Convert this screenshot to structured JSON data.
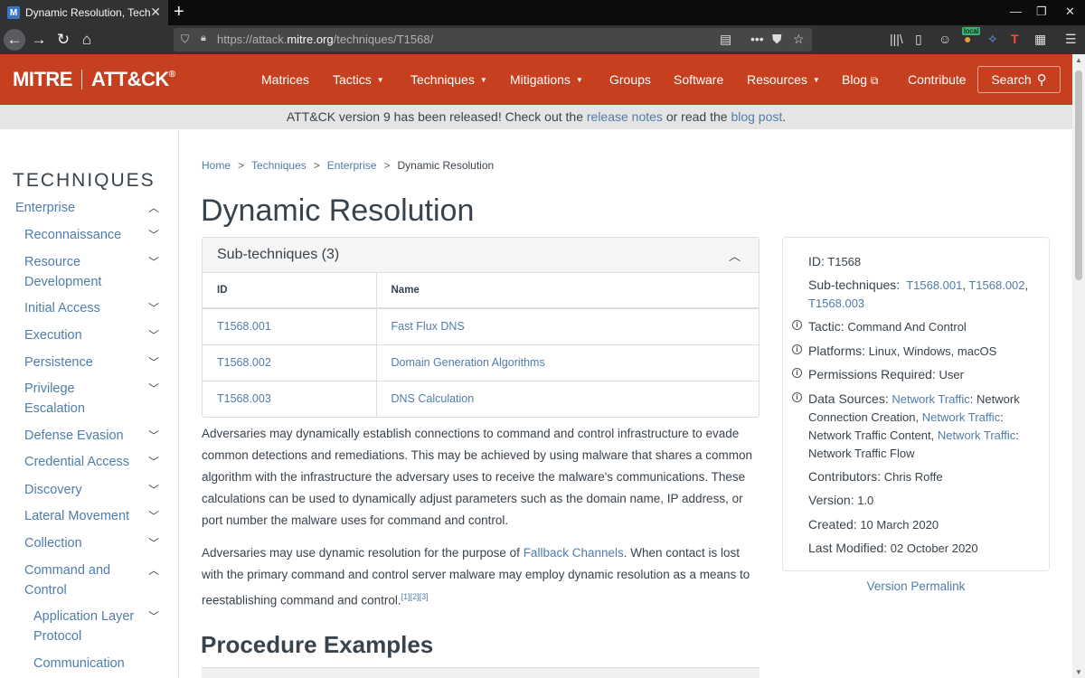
{
  "browser": {
    "tab_title": "Dynamic Resolution, Technique",
    "tab_favicon": "M",
    "url_host_prefix": "https://attack.",
    "url_host": "mitre.org",
    "url_path": "/techniques/T1568/",
    "local_badge": "local"
  },
  "header": {
    "logo_left": "MITRE",
    "logo_right": "ATT&CK",
    "logo_reg": "®",
    "nav": [
      {
        "label": "Matrices"
      },
      {
        "label": "Tactics"
      },
      {
        "label": "Techniques"
      },
      {
        "label": "Mitigations"
      },
      {
        "label": "Groups"
      },
      {
        "label": "Software"
      },
      {
        "label": "Resources"
      },
      {
        "label": "Blog"
      },
      {
        "label": "Contribute"
      }
    ],
    "search_label": "Search"
  },
  "banner": {
    "text_1": "ATT&CK version 9 has been released! Check out the ",
    "link_1": "release notes",
    "text_2": " or read the ",
    "link_2": "blog post",
    "text_3": "."
  },
  "sidebar": {
    "heading": "TECHNIQUES",
    "items": [
      {
        "label": "Enterprise",
        "chevron": "up"
      },
      {
        "label": "Reconnaissance",
        "chevron": "down"
      },
      {
        "label": "Resource Development",
        "chevron": "down"
      },
      {
        "label": "Initial Access",
        "chevron": "down"
      },
      {
        "label": "Execution",
        "chevron": "down"
      },
      {
        "label": "Persistence",
        "chevron": "down"
      },
      {
        "label": "Privilege Escalation",
        "chevron": "down"
      },
      {
        "label": "Defense Evasion",
        "chevron": "down"
      },
      {
        "label": "Credential Access",
        "chevron": "down"
      },
      {
        "label": "Discovery",
        "chevron": "down"
      },
      {
        "label": "Lateral Movement",
        "chevron": "down"
      },
      {
        "label": "Collection",
        "chevron": "down"
      },
      {
        "label": "Command and Control",
        "chevron": "up"
      },
      {
        "label": "Application Layer Protocol",
        "chevron": "down"
      },
      {
        "label": "Communication"
      }
    ]
  },
  "breadcrumb": [
    "Home",
    "Techniques",
    "Enterprise",
    "Dynamic Resolution"
  ],
  "page_title": "Dynamic Resolution",
  "subtechniques": {
    "title": "Sub-techniques (3)",
    "col_id": "ID",
    "col_name": "Name",
    "rows": [
      {
        "id": "T1568.001",
        "name": "Fast Flux DNS"
      },
      {
        "id": "T1568.002",
        "name": "Domain Generation Algorithms"
      },
      {
        "id": "T1568.003",
        "name": "DNS Calculation"
      }
    ]
  },
  "description": {
    "para1": "Adversaries may dynamically establish connections to command and control infrastructure to evade common detections and remediations. This may be achieved by using malware that shares a common algorithm with the infrastructure the adversary uses to receive the malware's communications. These calculations can be used to dynamically adjust parameters such as the domain name, IP address, or port number the malware uses for command and control.",
    "para2_a": "Adversaries may use dynamic resolution for the purpose of ",
    "para2_link": "Fallback Channels",
    "para2_b": ". When contact is lost with the primary command and control server malware may employ dynamic resolution as a means to reestablishing command and control.",
    "refs": "[1][2][3]"
  },
  "procedure_heading": "Procedure Examples",
  "card": {
    "id_label": "ID:",
    "id_value": "T1568",
    "subtech_label": "Sub-techniques:",
    "subtech_links": [
      "T1568.001",
      "T1568.002",
      "T1568.003"
    ],
    "tactic_label": "Tactic:",
    "tactic_value": "Command And Control",
    "platforms_label": "Platforms:",
    "platforms_value": "Linux, Windows, macOS",
    "perms_label": "Permissions Required:",
    "perms_value": "User",
    "datasrc_label": "Data Sources:",
    "datasrc_link": "Network Traffic",
    "datasrc_1": ": Network Connection Creation, ",
    "datasrc_2": ": Network Traffic Content, ",
    "datasrc_3": ": Network Traffic Flow",
    "contrib_label": "Contributors:",
    "contrib_value": "Chris Roffe",
    "version_label": "Version:",
    "version_value": "1.0",
    "created_label": "Created:",
    "created_value": "10 March 2020",
    "modified_label": "Last Modified:",
    "modified_value": "02 October 2020"
  },
  "permalink": "Version Permalink",
  "colors": {
    "header_bg": "#c63f1f",
    "link": "#4f7cac",
    "text": "#39434c",
    "banner_bg": "#e5e5e5"
  }
}
